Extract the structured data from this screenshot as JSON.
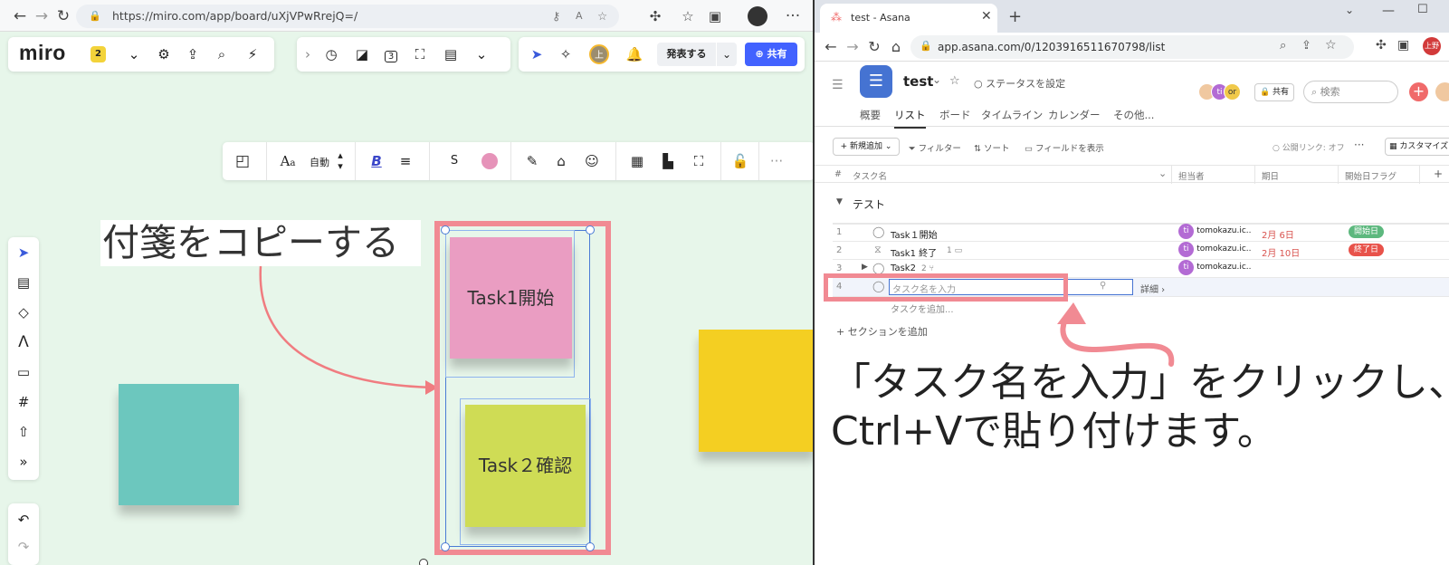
{
  "left_browser": {
    "url": "https://miro.com/app/board/uXjVPwRrejQ=/",
    "logo": "miro",
    "badge_count": "2",
    "counter_icon_label": "3",
    "avatar_initial": "上",
    "present_label": "発表する",
    "share_label": "共有",
    "icons": [
      "back-icon",
      "forward-icon",
      "reload-icon",
      "lock-icon",
      "key-icon",
      "read-aloud-icon",
      "star-icon",
      "extension-icon",
      "favorites-icon",
      "collections-icon",
      "profile-icon",
      "more-icon"
    ]
  },
  "format_toolbar": {
    "font_size_label": "自動",
    "size_s": "S",
    "bold": "B",
    "sticky_color": "#e693b9",
    "more": "···"
  },
  "board": {
    "caption_text": "付箋をコピーする",
    "sticky_task1": "Task1開始",
    "sticky_task2": "Task２確認",
    "colors": {
      "teal": "#6cc7be",
      "pink": "#ea9dc2",
      "lime": "#cfdc55",
      "yellow": "#f4cf22",
      "highlight": "#f18a93"
    }
  },
  "right_browser": {
    "tab_title": "test - Asana",
    "new_tab": "+",
    "url": "app.asana.com/0/1203916511670798/list",
    "avatar_initial": "上野"
  },
  "asana": {
    "project_title": "test",
    "status_label": "ステータスを設定",
    "avatars": [
      "",
      "ti",
      "or"
    ],
    "share_label": "共有",
    "search_placeholder": "検索",
    "tabs": [
      "概要",
      "リスト",
      "ボード",
      "タイムライン",
      "カレンダー",
      "その他..."
    ],
    "active_tab": "リスト",
    "toolbar": {
      "add_new": "新規追加",
      "filter": "フィルター",
      "sort": "ソート",
      "show_fields": "フィールドを表示",
      "public_link": "公開リンク: オフ",
      "more": "···",
      "customize": "カスタマイズ"
    },
    "columns": {
      "num": "#",
      "task_name": "タスク名",
      "assignee": "担当者",
      "due": "期日",
      "start_flag": "開始日フラグ",
      "add": "+"
    },
    "section_name": "テスト",
    "rows": [
      {
        "num": "1",
        "name": "Task１開始",
        "assignee": "tomokazu.ic...",
        "assignee_initial": "ti",
        "due": "2月 6日",
        "flag": "開始日",
        "flag_color": "#5db87e"
      },
      {
        "num": "2",
        "name": "Task1 終了",
        "extra": "1",
        "assignee": "tomokazu.ic...",
        "assignee_initial": "ti",
        "due": "2月 10日",
        "flag": "終了日",
        "flag_color": "#e8524a"
      },
      {
        "num": "3",
        "name": "Task2",
        "extra": "2",
        "assignee": "tomokazu.ic...",
        "assignee_initial": "ti",
        "due": "",
        "flag": ""
      },
      {
        "num": "4",
        "name": "",
        "placeholder": "タスク名を入力",
        "details": "詳細"
      }
    ],
    "add_task": "タスクを追加...",
    "add_section": "セクションを追加"
  },
  "annotation": {
    "line1": "「タスク名を入力」をクリックし、",
    "line2": "Ctrl+Vで貼り付けます。"
  }
}
